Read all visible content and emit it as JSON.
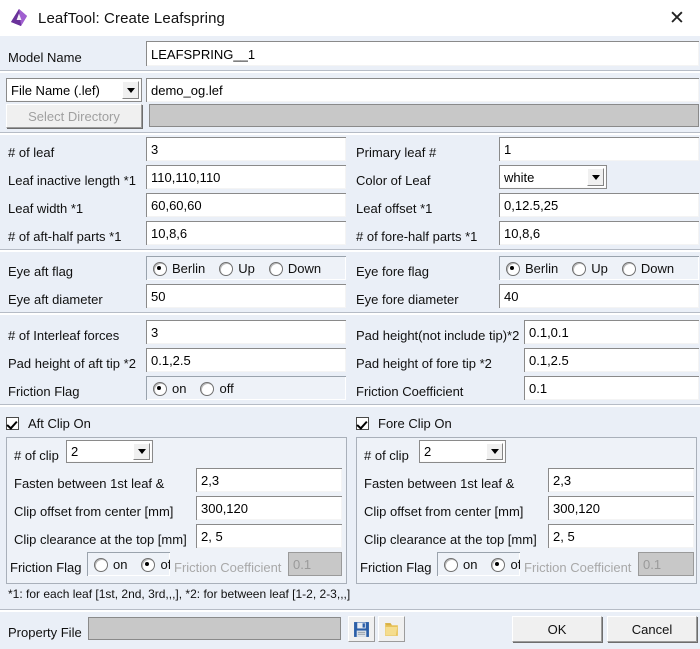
{
  "window": {
    "title": "LeafTool: Create Leafspring",
    "app_icon": "leaftool-logo-icon",
    "close_label": "✕"
  },
  "top": {
    "model_name_label": "Model Name",
    "model_name_value": "LEAFSPRING__1",
    "file_type_value": "File Name (.lef)",
    "file_name_value": "demo_og.lef",
    "select_directory_label": "Select Directory",
    "directory_value": ""
  },
  "leaf": {
    "left": [
      {
        "label": "# of leaf",
        "value": "3"
      },
      {
        "label": "Leaf inactive length *1",
        "value": "110,110,110"
      },
      {
        "label": "Leaf width *1",
        "value": "60,60,60"
      },
      {
        "label": "# of aft-half parts *1",
        "value": "10,8,6"
      }
    ],
    "right": [
      {
        "label": "Primary leaf #",
        "value": "1"
      },
      {
        "label": "Color of Leaf",
        "value": "white"
      },
      {
        "label": "Leaf offset *1",
        "value": "0,12.5,25"
      },
      {
        "label": "# of fore-half parts *1",
        "value": "10,8,6"
      }
    ]
  },
  "eye": {
    "aft_flag_label": "Eye aft flag",
    "aft_options": [
      "Berlin",
      "Up",
      "Down"
    ],
    "aft_selected": 0,
    "aft_diameter_label": "Eye aft diameter",
    "aft_diameter_value": "50",
    "fore_flag_label": "Eye fore flag",
    "fore_options": [
      "Berlin",
      "Up",
      "Down"
    ],
    "fore_selected": 0,
    "fore_diameter_label": "Eye fore diameter",
    "fore_diameter_value": "40"
  },
  "interleaf": {
    "forces_label": "# of Interleaf forces",
    "forces_value": "3",
    "pad_aft_tip_label": "Pad height of aft tip *2",
    "pad_aft_tip_value": "0.1,2.5",
    "friction_flag_label": "Friction Flag",
    "friction_options": [
      "on",
      "off"
    ],
    "friction_selected": 0,
    "pad_not_tip_label": "Pad height(not include tip)*2",
    "pad_not_tip_value": "0.1,0.1",
    "pad_fore_tip_label": "Pad height of fore tip *2",
    "pad_fore_tip_value": "0.1,2.5",
    "friction_coef_label": "Friction Coefficient",
    "friction_coef_value": "0.1"
  },
  "aft_clip": {
    "checkbox_label": "Aft Clip On",
    "checked": true,
    "num_clip_label": "# of clip",
    "num_clip_value": "2",
    "fasten_label": "Fasten between 1st leaf &",
    "fasten_value": "2,3",
    "offset_label": "Clip offset from center [mm]",
    "offset_value": "300,120",
    "clearance_label": "Clip clearance at the top [mm]",
    "clearance_value": "2, 5",
    "friction_flag_label": "Friction Flag",
    "friction_options": [
      "on",
      "of"
    ],
    "friction_selected": 1,
    "friction_coef_label": "Friction Coefficient",
    "friction_coef_value": "0.1"
  },
  "fore_clip": {
    "checkbox_label": "Fore Clip On",
    "checked": true,
    "num_clip_label": "# of clip",
    "num_clip_value": "2",
    "fasten_label": "Fasten between 1st leaf &",
    "fasten_value": "2,3",
    "offset_label": "Clip offset from center [mm]",
    "offset_value": "300,120",
    "clearance_label": "Clip clearance at the top [mm]",
    "clearance_value": "2, 5",
    "friction_flag_label": "Friction Flag",
    "friction_options": [
      "on",
      "of"
    ],
    "friction_selected": 1,
    "friction_coef_label": "Friction Coefficient",
    "friction_coef_value": "0.1"
  },
  "footnote": "*1: for each leaf [1st, 2nd, 3rd,,,], *2: for between leaf [1-2, 2-3,,,]",
  "footer": {
    "property_file_label": "Property File",
    "property_file_value": "",
    "save_icon": "floppy-save-icon",
    "open_icon": "folder-open-icon",
    "ok_label": "OK",
    "cancel_label": "Cancel"
  },
  "colors": {
    "background": "#eaeff7",
    "accent_icon": "#8e4ec6",
    "field_bg": "#ffffff",
    "disabled_bg": "#c8c8c8"
  }
}
